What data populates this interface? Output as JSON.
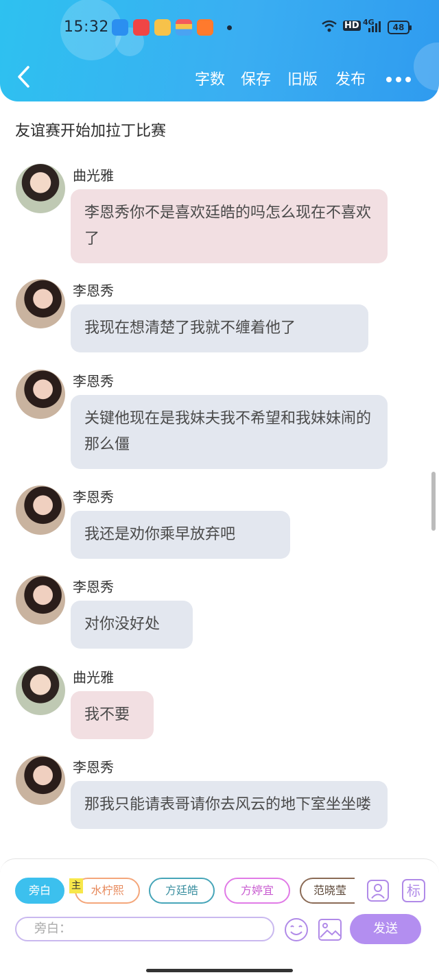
{
  "status_bar": {
    "time": "15:32",
    "network": "HD",
    "signal": "4G",
    "battery": "48"
  },
  "header": {
    "word_count": "字数",
    "save": "保存",
    "old_version": "旧版",
    "publish": "发布"
  },
  "story": {
    "title": "友谊赛开始加拉丁比赛"
  },
  "messages": [
    {
      "speaker": "曲光雅",
      "text": "李恩秀你不是喜欢廷皓的吗怎么现在不喜欢了"
    },
    {
      "speaker": "李恩秀",
      "text": "我现在想清楚了我就不缠着他了"
    },
    {
      "speaker": "李恩秀",
      "text": "关键他现在是我妹夫我不希望和我妹妹闹的那么僵"
    },
    {
      "speaker": "李恩秀",
      "text": "我还是劝你乘早放弃吧"
    },
    {
      "speaker": "李恩秀",
      "text": "对你没好处"
    },
    {
      "speaker": "曲光雅",
      "text": "我不要"
    },
    {
      "speaker": "李恩秀",
      "text": "那我只能请表哥请你去风云的地下室坐坐喽"
    }
  ],
  "roles": {
    "narration": "旁白",
    "main_badge": "主",
    "r1": "水柠熙",
    "r2": "方廷皓",
    "r3": "方婷宜",
    "r4": "范晓莹"
  },
  "toolbar": {
    "tag_label": "标"
  },
  "composer": {
    "placeholder": "旁白：",
    "send": "发送"
  },
  "colors": {
    "header": "#3aaef2",
    "send": "#b38ef0",
    "bubble_pink": "#f2dfe2",
    "bubble_grey": "#e3e7ef"
  }
}
